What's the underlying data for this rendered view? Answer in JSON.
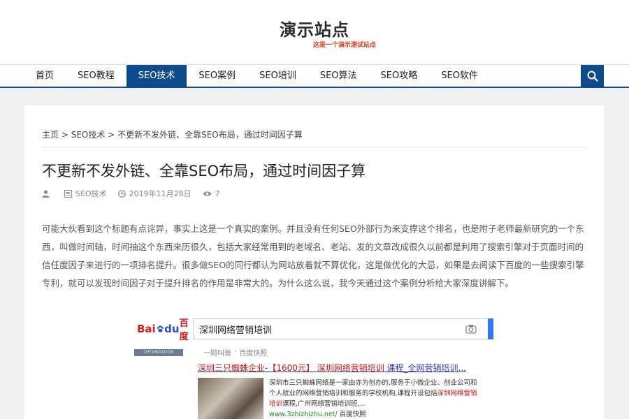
{
  "site": {
    "title": "演示站点",
    "subtitle": "这是一个演示测试站点"
  },
  "nav": {
    "items": [
      {
        "label": "首页",
        "active": false
      },
      {
        "label": "SEO教程",
        "active": false
      },
      {
        "label": "SEO技术",
        "active": true
      },
      {
        "label": "SEO案例",
        "active": false
      },
      {
        "label": "SEO培训",
        "active": false
      },
      {
        "label": "SEO算法",
        "active": false
      },
      {
        "label": "SEO攻略",
        "active": false
      },
      {
        "label": "SEO软件",
        "active": false
      }
    ],
    "search_icon": "search-icon"
  },
  "breadcrumb": {
    "home": "主页",
    "sep": ">",
    "category": "SEO技术",
    "current": "不更新不发外链、全靠SEO布局，通过时间因子算"
  },
  "article": {
    "title": "不更新不发外链、全靠SEO布局，通过时间因子算",
    "meta": {
      "author_icon": "user-icon",
      "category_icon": "list-icon",
      "category": "SEO技术",
      "date_icon": "clock-icon",
      "date": "2019年11月28日",
      "views_icon": "eye-icon",
      "views": "7"
    },
    "body": "可能大伙看到这个标题有点诧异，事实上这是一个真实的案例。并且没有任何SEO外部行为来支撑这个排名，也是附子老师最新研究的一个东西，叫做时间轴，时间抽这个东西来历很久，包括大家经常用到的老域名、老站、发的文章改成很久以前都是利用了搜索引擎对于页面时间的信任度因子来进行的一项排名提升。很多做SEO的同行都认为网站放着就不算优化，这是做优化的大忌，如果是去阅读下百度的一些搜索引擎专利，就可以发现时间因子对于提升排名的作用是非常大的。为什么这么说，我今天通过这个案例分析给大家深度讲解下。"
  },
  "figure": {
    "logo_bai": "Bai",
    "logo_du": "du",
    "logo_cn": "百度",
    "query": "深圳网络营销培训",
    "badge": "OPTIMIZATION",
    "result_author": "一网叫兽",
    "result_source": "百度快照",
    "result_title_a": "深圳三只蜘蛛企业-【1600元】",
    "result_title_b": "深圳网络营销培训",
    "result_title_c": "课程_全网营销培训...",
    "snippet_1": "深圳市三只蜘蛛网络是一家由亦为创办的,服务于小微企业、创业公司和个人就业的网络营销培训和服务的学校机构,课程开设包括",
    "snippet_red1": "深圳网络营销培训",
    "snippet_2": "课程,广州网络营销培训班,...",
    "snippet_url": "www.3zhizhizhu.net/",
    "snippet_tail": "百度快照",
    "colors": {
      "accent": "#0d4b8c",
      "link": "#2a37b8",
      "red": "#cc1111"
    }
  }
}
